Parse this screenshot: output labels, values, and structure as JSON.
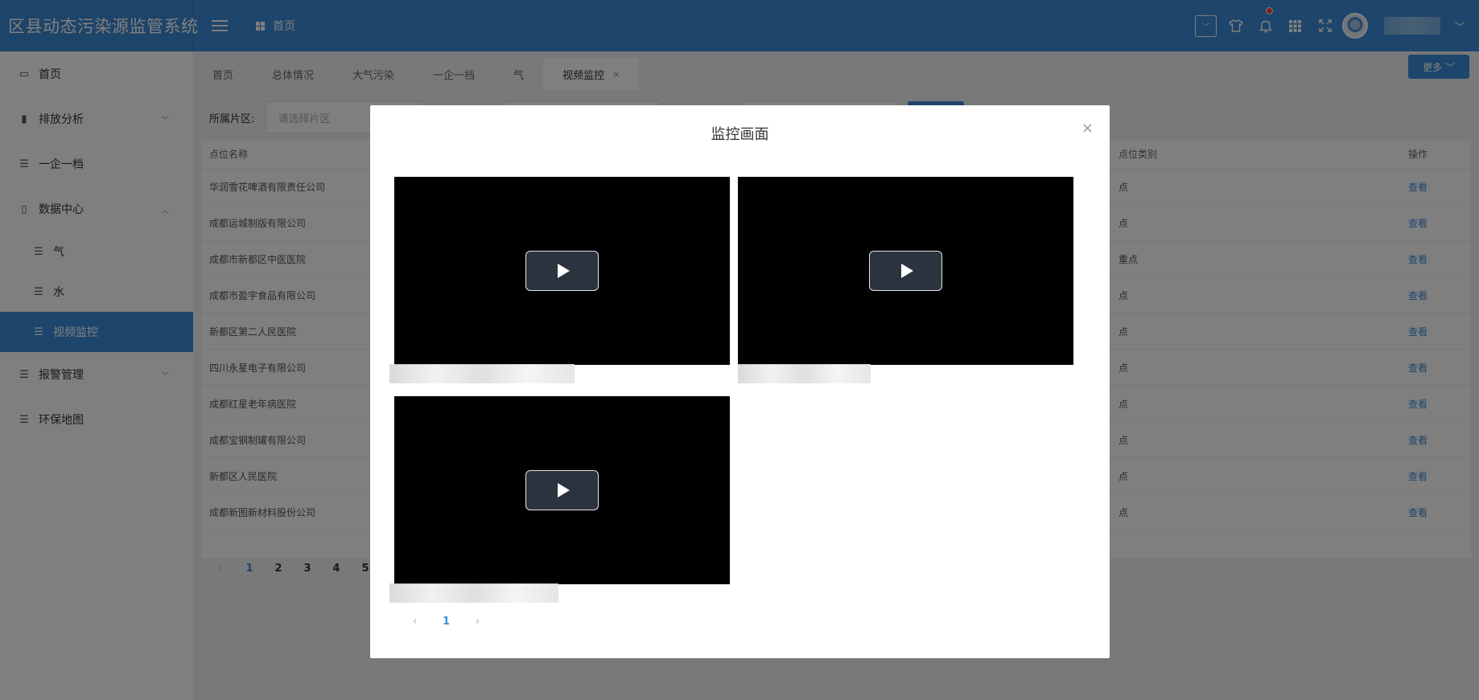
{
  "header": {
    "app_title": "区县动态污染源监管系统",
    "breadcrumb": "首页",
    "select_caret": "﹀",
    "user_caret": "﹀"
  },
  "sidebar": {
    "items": [
      {
        "label": "首页",
        "icon": "monitor-icon",
        "glyph": "▭"
      },
      {
        "label": "排放分析",
        "icon": "bar-chart-icon",
        "glyph": "▮",
        "chevron": "﹀"
      },
      {
        "label": "一企一档",
        "icon": "list-icon",
        "glyph": "☰"
      },
      {
        "label": "数据中心",
        "icon": "book-icon",
        "glyph": "▯",
        "chevron": "︿"
      },
      {
        "label": "气",
        "icon": "list-icon",
        "glyph": "☰"
      },
      {
        "label": "水",
        "icon": "list-icon",
        "glyph": "☰"
      },
      {
        "label": "视频监控",
        "icon": "list-icon",
        "glyph": "☰"
      },
      {
        "label": "报警管理",
        "icon": "list-icon",
        "glyph": "☰",
        "chevron": "﹀"
      },
      {
        "label": "环保地图",
        "icon": "list-icon",
        "glyph": "☰"
      }
    ]
  },
  "tabs": {
    "items": [
      "首页",
      "总体情况",
      "大气污染",
      "一企一档",
      "气",
      "视频监控"
    ],
    "close_glyph": "×",
    "more_label": "更多 ﹀"
  },
  "filters": {
    "area_label": "所属片区:",
    "area_placeholder": "请选择片区"
  },
  "table": {
    "headers": {
      "name": "点位名称",
      "type": "点位类别",
      "op": "操作"
    },
    "rows": [
      {
        "name": "华润雪花啤酒有限责任公司",
        "type": "点",
        "op": "查看"
      },
      {
        "name": "成都运城制版有限公司",
        "type": "点",
        "op": "查看"
      },
      {
        "name": "成都市新都区中医医院",
        "type": "重点",
        "op": "查看"
      },
      {
        "name": "成都市盈宇食品有限公司",
        "type": "点",
        "op": "查看"
      },
      {
        "name": "新都区第二人民医院",
        "type": "点",
        "op": "查看"
      },
      {
        "name": "四川永星电子有限公司",
        "type": "点",
        "op": "查看"
      },
      {
        "name": "成都红星老年病医院",
        "type": "点",
        "op": "查看"
      },
      {
        "name": "成都宝钢制罐有限公司",
        "type": "点",
        "op": "查看"
      },
      {
        "name": "新都区人民医院",
        "type": "点",
        "op": "查看"
      },
      {
        "name": "成都新图新材料股份公司",
        "type": "点",
        "op": "查看"
      }
    ],
    "pages": [
      "1",
      "2",
      "3",
      "4",
      "5"
    ],
    "prev": "‹"
  },
  "modal": {
    "title": "监控画面",
    "close": "×",
    "pager": {
      "prev": "‹",
      "current": "1",
      "next": "›"
    }
  }
}
